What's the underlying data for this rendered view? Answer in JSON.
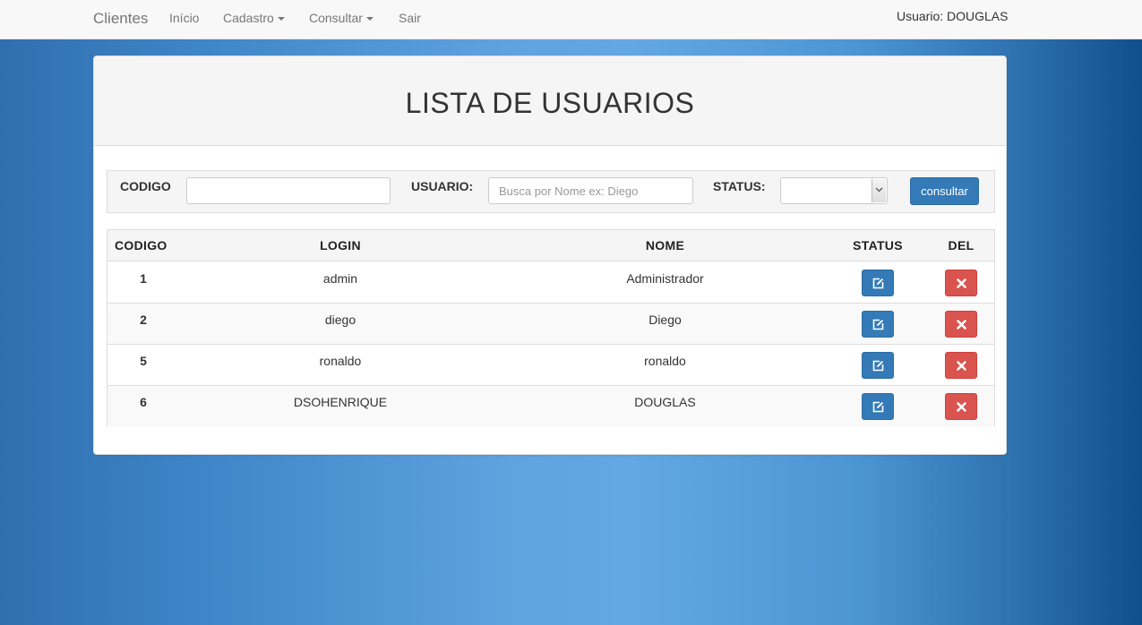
{
  "navbar": {
    "brand": "Clientes",
    "links": [
      {
        "label": "Início"
      },
      {
        "label": "Cadastro"
      },
      {
        "label": "Consultar"
      },
      {
        "label": "Sair"
      }
    ],
    "user": "Usuario: DOUGLAS"
  },
  "panel": {
    "title": "LISTA DE USUARIOS"
  },
  "filters": {
    "codigo_label": "CODIGO",
    "codigo_value": "",
    "usuario_label": "USUARIO:",
    "usuario_placeholder": "Busca por Nome ex: Diego",
    "status_label": "STATUS:",
    "status_value": "",
    "button_label": "consultar"
  },
  "table": {
    "headers": [
      "CODIGO",
      "LOGIN",
      "NOME",
      "STATUS",
      "DEL"
    ],
    "rows": [
      {
        "codigo": "1",
        "login": "admin",
        "nome": "Administrador"
      },
      {
        "codigo": "2",
        "login": "diego",
        "nome": "Diego"
      },
      {
        "codigo": "5",
        "login": "ronaldo",
        "nome": "ronaldo"
      },
      {
        "codigo": "6",
        "login": "DSOHENRIQUE",
        "nome": "DOUGLAS"
      }
    ],
    "status_icon": "edit-icon",
    "del_icon": "remove-icon"
  },
  "colors": {
    "primary": "#337ab7",
    "danger": "#d9534f"
  }
}
